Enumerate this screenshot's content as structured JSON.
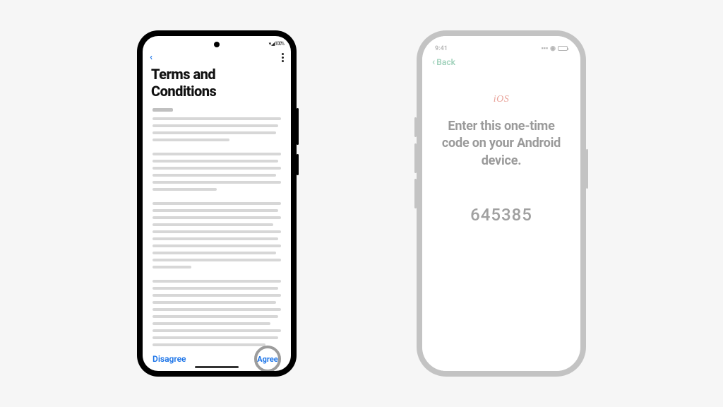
{
  "android": {
    "status": {
      "signal": "▾.◢ 100%"
    },
    "title": "Terms and Conditions",
    "footer": {
      "disagree": "Disagree",
      "agree": "Agree"
    }
  },
  "iphone": {
    "status": {
      "time": "9:41"
    },
    "nav": {
      "back": "Back"
    },
    "ios_label": "iOS",
    "headline": "Enter this one-time code on your Android device.",
    "code": "645385"
  }
}
